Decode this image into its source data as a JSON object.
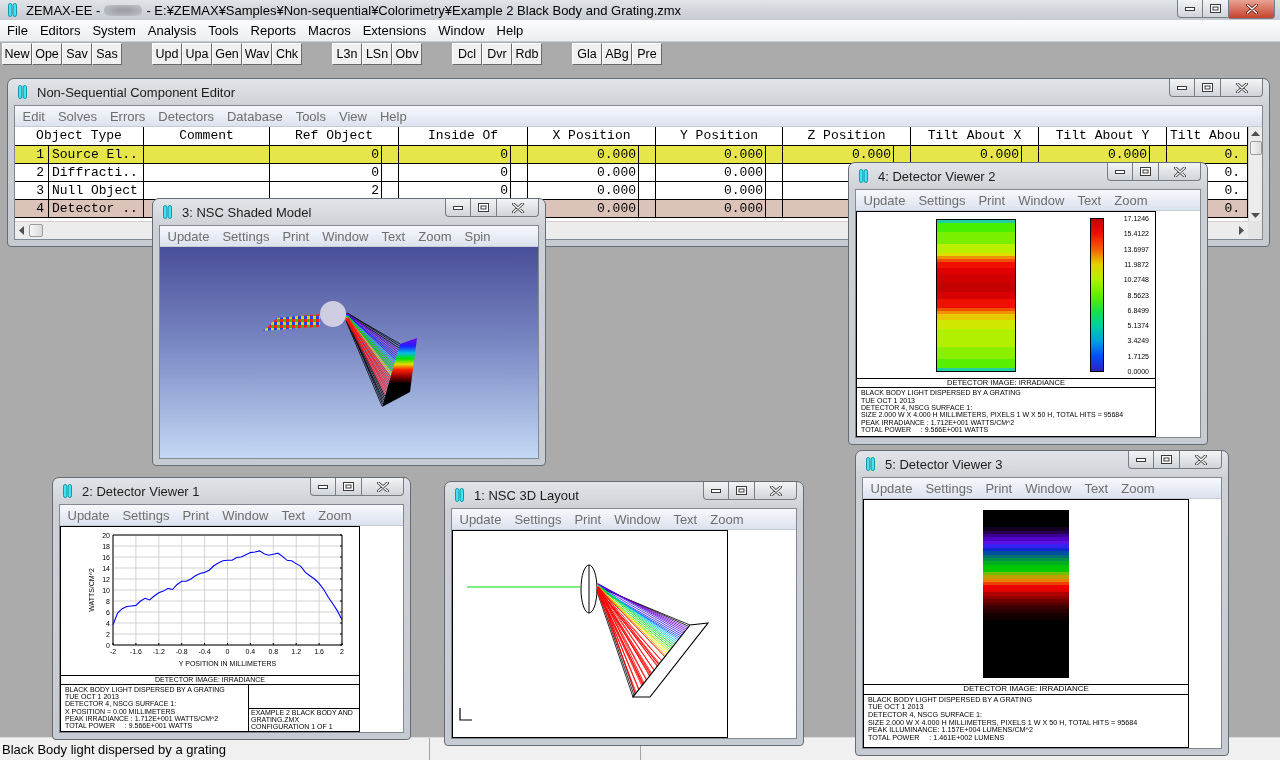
{
  "window": {
    "app_title": "ZEMAX-EE -",
    "file_path": "- E:¥ZEMAX¥Samples¥Non-sequential¥Colorimetry¥Example 2 Black Body and Grating.zmx"
  },
  "menu": [
    "File",
    "Editors",
    "System",
    "Analysis",
    "Tools",
    "Reports",
    "Macros",
    "Extensions",
    "Window",
    "Help"
  ],
  "toolbar": [
    [
      "New",
      "Ope",
      "Sav",
      "Sas"
    ],
    [
      "Upd",
      "Upa",
      "Gen",
      "Wav",
      "Chk"
    ],
    [
      "L3n",
      "LSn",
      "Obv"
    ],
    [
      "Dcl",
      "Dvr",
      "Rdb"
    ],
    [
      "Gla",
      "ABg",
      "Pre"
    ]
  ],
  "editor": {
    "title": "Non-Sequential Component Editor",
    "menu": [
      "Edit",
      "Solves",
      "Errors",
      "Detectors",
      "Database",
      "Tools",
      "View",
      "Help"
    ],
    "columns": [
      "Object Type",
      "Comment",
      "Ref Object",
      "Inside Of",
      "X Position",
      "Y Position",
      "Z Position",
      "Tilt About X",
      "Tilt About Y",
      "Tilt Abou"
    ],
    "rows": [
      {
        "number": "1",
        "color": "#e6e64a",
        "cells": [
          "Source El..",
          null,
          "0",
          "0",
          "0.000",
          "0.000",
          "0.000",
          "0.000",
          "0.000",
          "0."
        ]
      },
      {
        "number": "2",
        "color": "#ffffff",
        "cells": [
          "Diffracti..",
          null,
          "0",
          "0",
          "0.000",
          "0.000",
          null,
          null,
          null,
          "0."
        ]
      },
      {
        "number": "3",
        "color": "#ffffff",
        "cells": [
          "Null Object",
          null,
          "2",
          "0",
          "0.000",
          "0.000",
          null,
          null,
          null,
          "0."
        ]
      },
      {
        "number": "4",
        "color": "#dcc3b9",
        "cells": [
          "Detector ..",
          null,
          null,
          null,
          "0.000",
          "0.000",
          null,
          null,
          null,
          "0."
        ]
      }
    ]
  },
  "windows": [
    {
      "kind": "shaded_model",
      "title": "3: NSC Shaded Model",
      "menu": [
        "Update",
        "Settings",
        "Print",
        "Window",
        "Text",
        "Zoom",
        "Spin"
      ]
    },
    {
      "kind": "false_color",
      "title": "4: Detector Viewer 2",
      "menu": [
        "Update",
        "Settings",
        "Print",
        "Window",
        "Text",
        "Zoom"
      ],
      "plot": {
        "header": "DETECTOR IMAGE: IRRADIANCE",
        "colorbar_ticks": [
          "17.1246",
          "15.4122",
          "13.6997",
          "11.9872",
          "10.2748",
          "8.5623",
          "6.8499",
          "5.1374",
          "3.4249",
          "1.7125",
          "0.0000"
        ],
        "info": [
          "BLACK BODY LIGHT DISPERSED BY A GRATING",
          "TUE OCT 1 2013",
          "DETECTOR 4, NSCG SURFACE 1:",
          "SIZE 2.000 W X 4.000 H MILLIMETERS, PIXELS 1 W X 50 H, TOTAL HITS = 95684",
          "PEAK IRRADIANCE : 1.712E+001 WATTS/CM^2",
          "TOTAL POWER     : 9.566E+001 WATTS"
        ]
      }
    },
    {
      "kind": "line_plot",
      "title": "2: Detector Viewer 1",
      "menu": [
        "Update",
        "Settings",
        "Print",
        "Window",
        "Text",
        "Zoom"
      ],
      "plot": {
        "chart_data": {
          "type": "line",
          "xlabel": "Y POSITION IN MILLIMETERS",
          "ylabel": "WATTS/CM^2",
          "x": [
            -2,
            -1.92,
            -1.84,
            -1.76,
            -1.68,
            -1.6,
            -1.52,
            -1.44,
            -1.36,
            -1.28,
            -1.2,
            -1.12,
            -1.04,
            -0.96,
            -0.88,
            -0.8,
            -0.72,
            -0.64,
            -0.56,
            -0.48,
            -0.4,
            -0.32,
            -0.24,
            -0.16,
            -0.08,
            0,
            0.08,
            0.16,
            0.24,
            0.32,
            0.4,
            0.48,
            0.56,
            0.64,
            0.72,
            0.8,
            0.88,
            0.96,
            1.04,
            1.12,
            1.2,
            1.28,
            1.36,
            1.44,
            1.52,
            1.6,
            1.68,
            1.76,
            1.84,
            1.92,
            2
          ],
          "series": [
            {
              "color": "#0000ff",
              "values": [
                3.7,
                5.8,
                6.6,
                7.0,
                7.1,
                7.2,
                8.0,
                8.5,
                8.2,
                8.9,
                9.5,
                9.8,
                10.3,
                10.1,
                11.0,
                11.6,
                11.6,
                12.0,
                12.6,
                13.0,
                13.2,
                13.6,
                14.4,
                14.9,
                15.3,
                15.4,
                15.4,
                15.9,
                16.0,
                16.4,
                16.8,
                16.9,
                17.1,
                16.6,
                16.3,
                16.5,
                16.7,
                16.1,
                15.4,
                15.3,
                14.8,
                14.3,
                13.2,
                12.6,
                12.0,
                11.2,
                10.1,
                8.7,
                7.5,
                6.2,
                4.6
              ]
            }
          ],
          "xlim": [
            -2,
            2
          ],
          "ylim": [
            0,
            20
          ],
          "xticks": [
            -2,
            -1.6,
            -1.2,
            -0.8,
            -0.4,
            0,
            0.4,
            0.8,
            1.2,
            1.6,
            2
          ],
          "yticks": [
            0,
            2,
            4,
            6,
            8,
            10,
            12,
            14,
            16,
            18,
            20
          ],
          "grid": true
        },
        "header": "DETECTOR IMAGE: IRRADIANCE",
        "info": [
          "BLACK BODY LIGHT DISPERSED BY A GRATING",
          "TUE OCT 1 2013",
          "DETECTOR 4, NSCG SURFACE 1:",
          "X POSITION = 0.00 MILLIMETERS",
          "PEAK IRRADIANCE : 1.712E+001 WATTS/CM^2",
          "TOTAL POWER     : 9.566E+001 WATTS"
        ],
        "file": "EXAMPLE 2 BLACK BODY AND GRATING.ZMX",
        "config": "CONFIGURATION 1 OF 1"
      }
    },
    {
      "kind": "layout_3d",
      "title": "1: NSC 3D Layout",
      "menu": [
        "Update",
        "Settings",
        "Print",
        "Window",
        "Text",
        "Zoom"
      ]
    },
    {
      "kind": "true_color",
      "title": "5: Detector Viewer 3",
      "menu": [
        "Update",
        "Settings",
        "Print",
        "Window",
        "Text",
        "Zoom"
      ],
      "plot": {
        "header": "DETECTOR IMAGE: IRRADIANCE",
        "info": [
          "BLACK BODY LIGHT DISPERSED BY A GRATING",
          "TUE OCT 1 2013",
          "DETECTOR 4, NSCG SURFACE 1:",
          "SIZE 2.000 W X 4.000 H MILLIMETERS, PIXELS 1 W X 50 H, TOTAL HITS = 95684",
          "PEAK ILLUMINANCE: 1.157E+004 LUMENS/CM^2",
          "TOTAL POWER     : 1.461E+002 LUMENS"
        ]
      }
    }
  ],
  "status_bar": {
    "text": "Black Body light dispersed by a grating"
  }
}
